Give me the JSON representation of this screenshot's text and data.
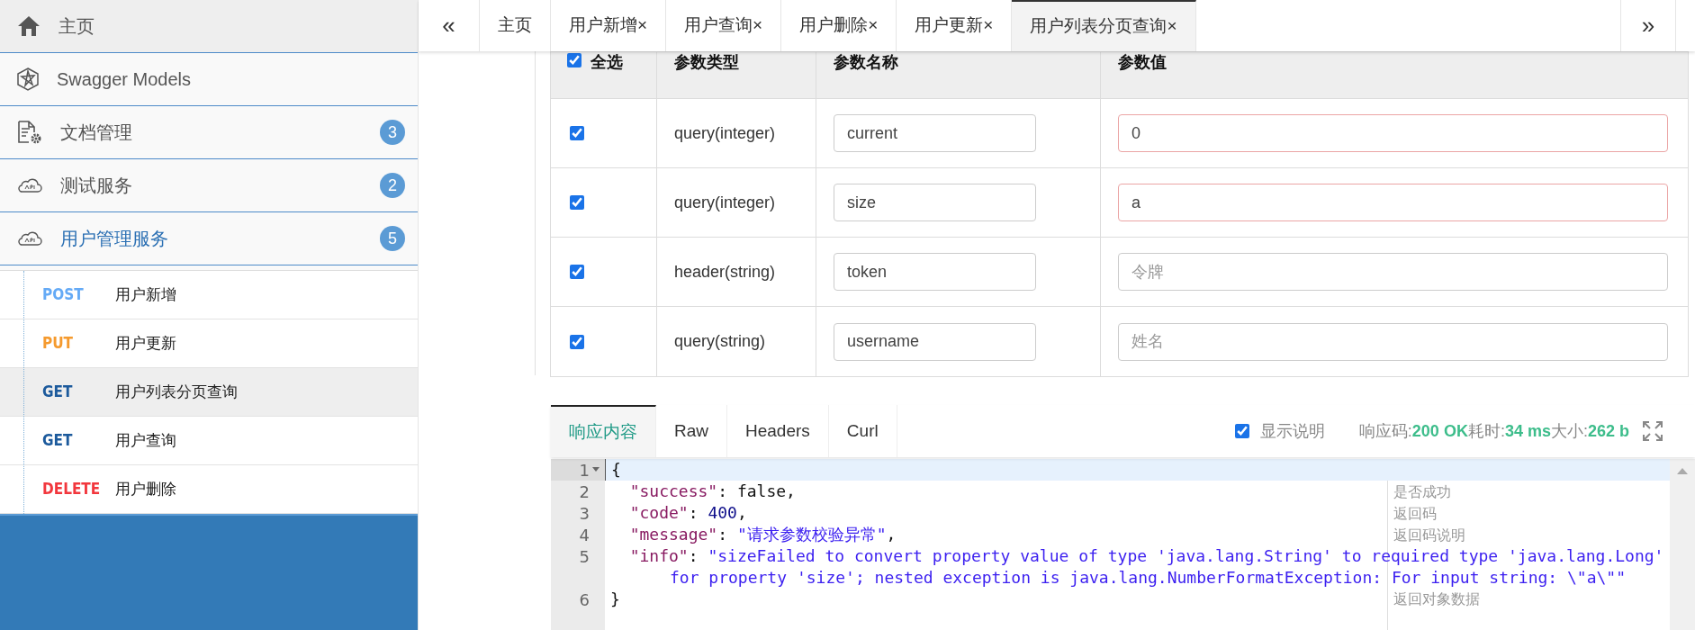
{
  "sidebar": {
    "items": [
      {
        "kind": "home",
        "label": "主页",
        "expanded": false
      },
      {
        "kind": "models",
        "label": "Swagger Models",
        "expanded": false
      },
      {
        "kind": "docs",
        "label": "文档管理",
        "badge": "3",
        "expanded": false
      },
      {
        "kind": "service",
        "label": "测试服务",
        "badge": "2",
        "expanded": false
      },
      {
        "kind": "service",
        "label": "用户管理服务",
        "badge": "5",
        "expanded": true,
        "children": [
          {
            "method": "POST",
            "label": "用户新增",
            "selected": false
          },
          {
            "method": "PUT",
            "label": "用户更新",
            "selected": false
          },
          {
            "method": "GET",
            "label": "用户列表分页查询",
            "selected": true
          },
          {
            "method": "GET",
            "label": "用户查询",
            "selected": false
          },
          {
            "method": "DELETE",
            "label": "用户删除",
            "selected": false
          }
        ]
      }
    ]
  },
  "tabs": {
    "prev": "«",
    "next": "»",
    "items": [
      {
        "label": "主页",
        "selected": false
      },
      {
        "label": "用户新增×",
        "selected": false
      },
      {
        "label": "用户查询×",
        "selected": false
      },
      {
        "label": "用户删除×",
        "selected": false
      },
      {
        "label": "用户更新×",
        "selected": false
      },
      {
        "label": "用户列表分页查询×",
        "selected": true
      }
    ]
  },
  "params": {
    "select_all": {
      "label": "全选",
      "checked": true
    },
    "columns": [
      "参数类型",
      "参数名称",
      "参数值"
    ],
    "rows": [
      {
        "checked": true,
        "type": "query(integer)",
        "name": "current",
        "value": "0",
        "error": true
      },
      {
        "checked": true,
        "type": "query(integer)",
        "name": "size",
        "value": "a",
        "error": true
      },
      {
        "checked": true,
        "type": "header(string)",
        "name": "token",
        "placeholder": "令牌",
        "error": false
      },
      {
        "checked": true,
        "type": "query(string)",
        "name": "username",
        "placeholder": "姓名",
        "error": false
      }
    ]
  },
  "response": {
    "tabs": [
      {
        "label": "响应内容",
        "selected": true
      },
      {
        "label": "Raw",
        "selected": false
      },
      {
        "label": "Headers",
        "selected": false
      },
      {
        "label": "Curl",
        "selected": false
      }
    ],
    "show_notes": {
      "label": "显示说明",
      "checked": true
    },
    "stats": [
      {
        "label": "响应码:",
        "value": "200 OK"
      },
      {
        "label": "耗时:",
        "value": "34 ms"
      },
      {
        "label": "大小:",
        "value": "262 b"
      }
    ],
    "lines": [
      {
        "number": "1",
        "fold": true,
        "active": true,
        "tokens": [
          {
            "kind": "punct",
            "text": "{"
          }
        ]
      },
      {
        "number": "2",
        "fold": false,
        "active": false,
        "note": "是否成功",
        "tokens": [
          {
            "kind": "key",
            "text": "  \"success\""
          },
          {
            "kind": "punct",
            "text": ": "
          },
          {
            "kind": "bool",
            "text": "false"
          },
          {
            "kind": "punct",
            "text": ","
          }
        ]
      },
      {
        "number": "3",
        "fold": false,
        "active": false,
        "note": "返回码",
        "tokens": [
          {
            "kind": "key",
            "text": "  \"code\""
          },
          {
            "kind": "punct",
            "text": ": "
          },
          {
            "kind": "number",
            "text": "400"
          },
          {
            "kind": "punct",
            "text": ","
          }
        ]
      },
      {
        "number": "4",
        "fold": false,
        "active": false,
        "note": "返回码说明",
        "tokens": [
          {
            "kind": "key",
            "text": "  \"message\""
          },
          {
            "kind": "punct",
            "text": ": "
          },
          {
            "kind": "string",
            "text": "\"请求参数校验异常\""
          },
          {
            "kind": "punct",
            "text": ","
          }
        ]
      },
      {
        "number": "5",
        "fold": false,
        "active": false,
        "note": "返回对象数据",
        "tokens": [
          {
            "kind": "key",
            "text": "  \"info\""
          },
          {
            "kind": "punct",
            "text": ": "
          },
          {
            "kind": "string",
            "text": "\"sizeFailed to convert property value of type 'java.lang.String' to required type 'java.lang.Long'"
          }
        ],
        "wrap": [
          {
            "kind": "string",
            "text": "for property 'size'; nested exception is java.lang.NumberFormatException: For input string: \\\"a\\\"\""
          }
        ]
      },
      {
        "number": "6",
        "fold": false,
        "active": false,
        "tokens": [
          {
            "kind": "punct",
            "text": "}"
          }
        ]
      }
    ]
  }
}
